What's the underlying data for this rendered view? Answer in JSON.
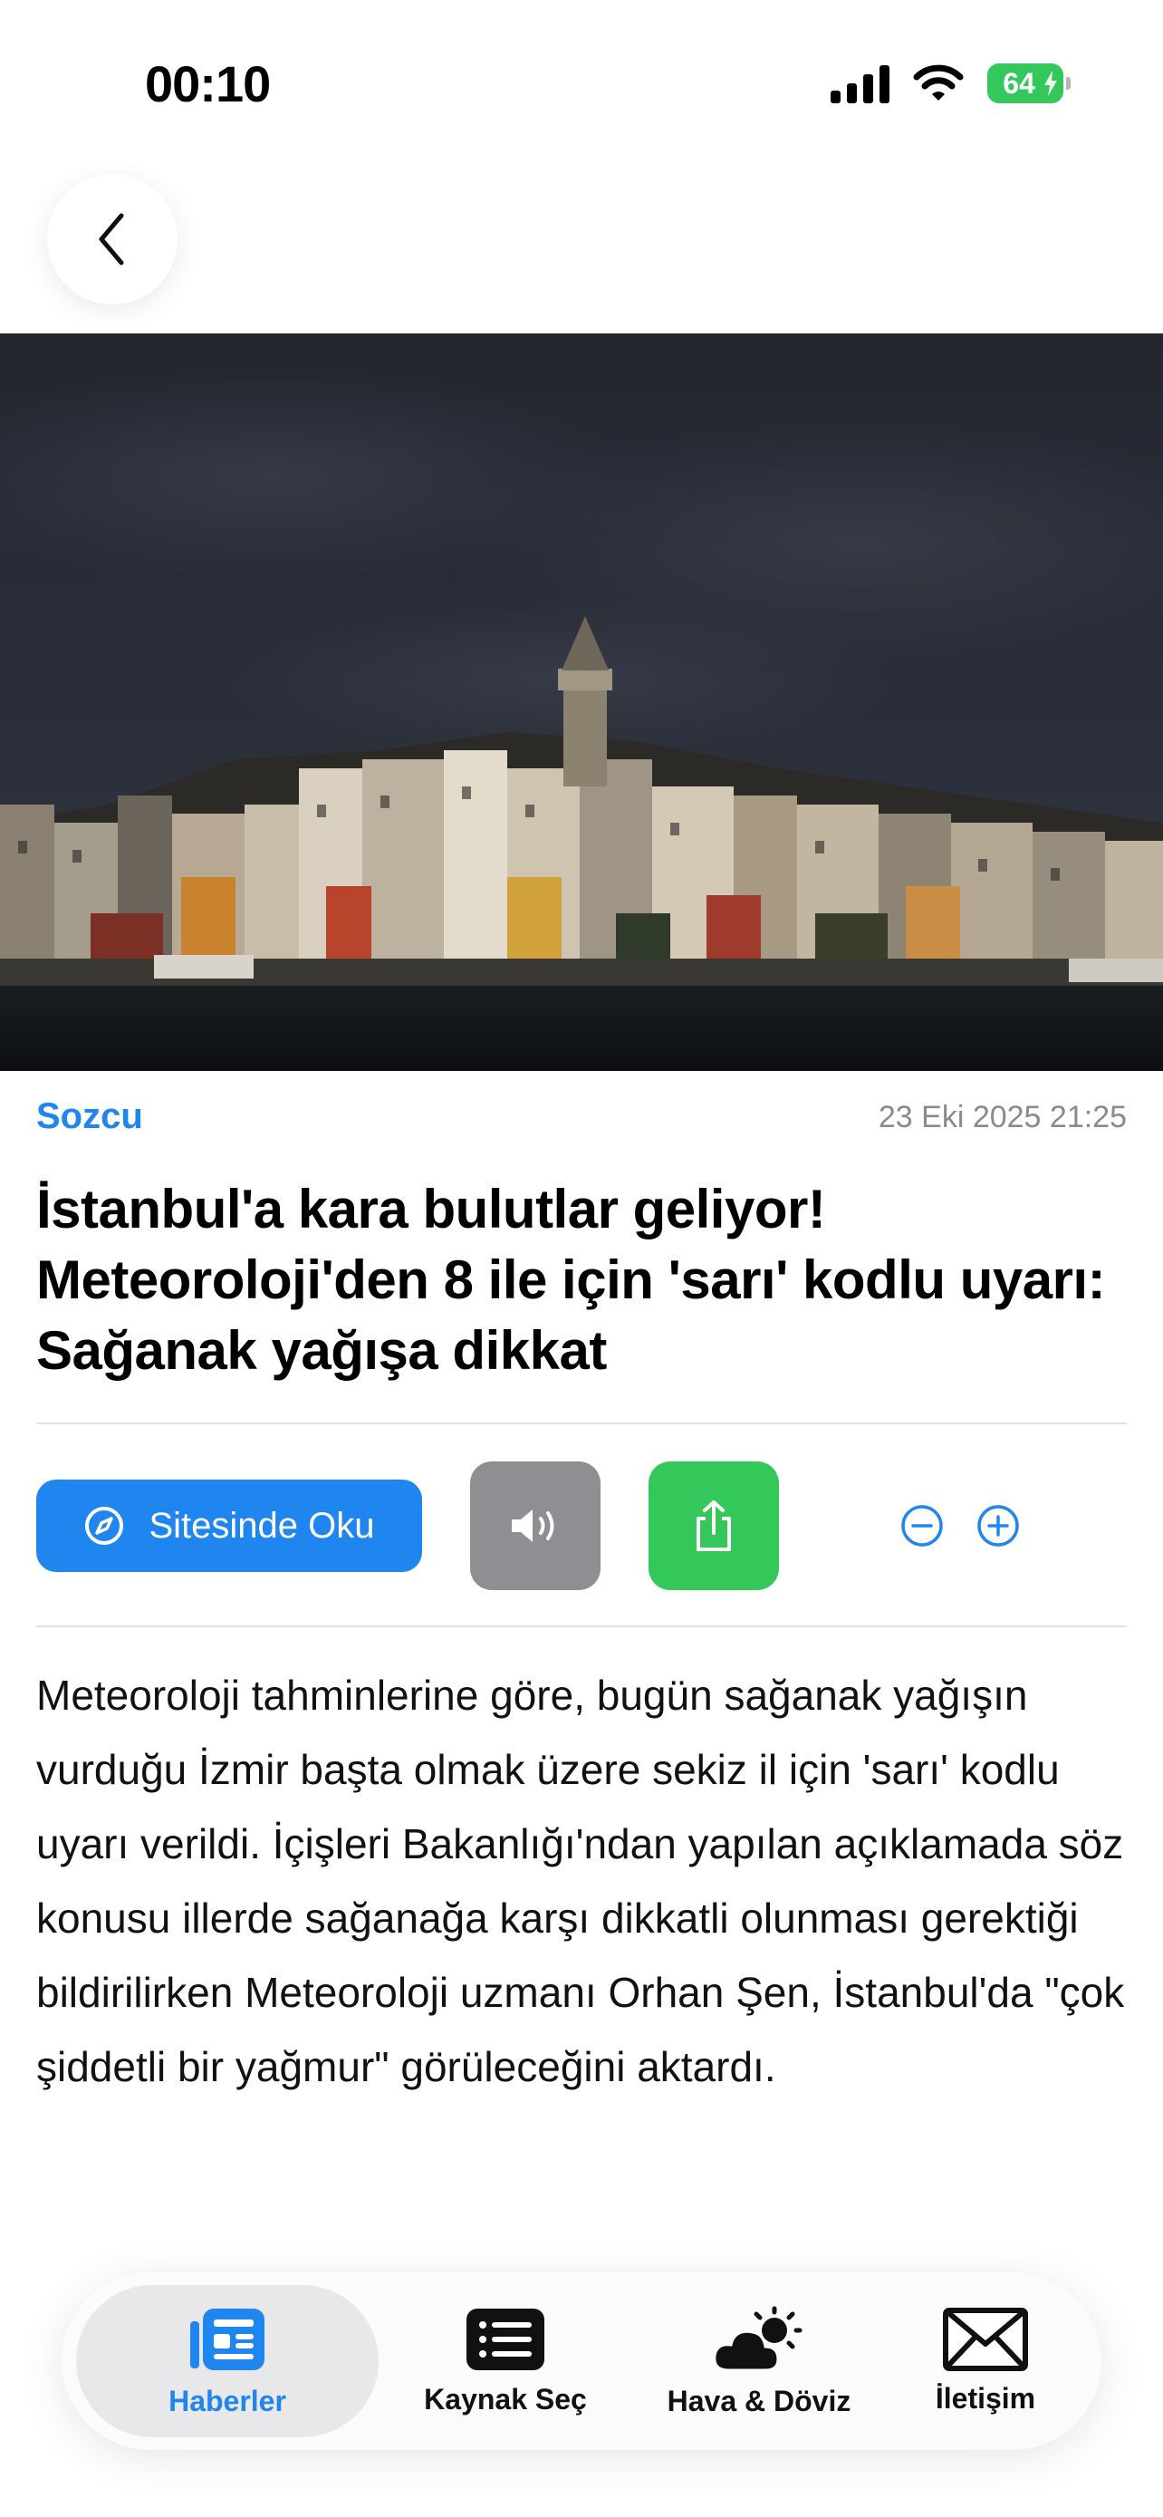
{
  "status_bar": {
    "time": "00:10",
    "battery_level": "64",
    "icons": [
      "signal-icon",
      "wifi-icon",
      "battery-charging-icon"
    ]
  },
  "nav": {
    "back_icon": "chevron-left-icon"
  },
  "article": {
    "source": "Sozcu",
    "date": "23 Eki 2025 21:25",
    "title": "İstanbul'a kara bulutlar geliyor! Meteoroloji'den 8 ile için 'sarı' kodlu uyarı: Sağanak yağışa dikkat",
    "body": "Meteoroloji tahminlerine göre, bugün sağanak yağışın vurduğu İzmir başta olmak üzere sekiz il için 'sarı' kodlu uyarı verildi. İçişleri Bakanlığı'ndan yapılan açıklamada söz konusu illerde sağanağa karşı dikkatli olunması gerektiği bildirilirken Meteoroloji uzmanı Orhan Şen, İstanbul'da \"çok şiddetli bir yağmur\" görüleceğini aktardı.",
    "image_icon": "city-skyline-photo"
  },
  "actions": {
    "read_on_site": "Sitesinde Oku",
    "read_icon": "compass-icon",
    "speak_icon": "speaker-icon",
    "share_icon": "share-icon",
    "font_decrease_icon": "minus-circle-icon",
    "font_increase_icon": "plus-circle-icon"
  },
  "tab_bar": {
    "tabs": [
      {
        "label": "Haberler",
        "icon": "newspaper-icon",
        "active": true
      },
      {
        "label": "Kaynak Seç",
        "icon": "list-icon",
        "active": false
      },
      {
        "label": "Hava & Döviz",
        "icon": "cloud-sun-icon",
        "active": false
      },
      {
        "label": "İletişim",
        "icon": "envelope-icon",
        "active": false
      }
    ]
  },
  "colors": {
    "accent": "#1f86f0",
    "share_green": "#34c759",
    "speak_gray": "#8e8e93",
    "battery_green": "#34c759"
  }
}
